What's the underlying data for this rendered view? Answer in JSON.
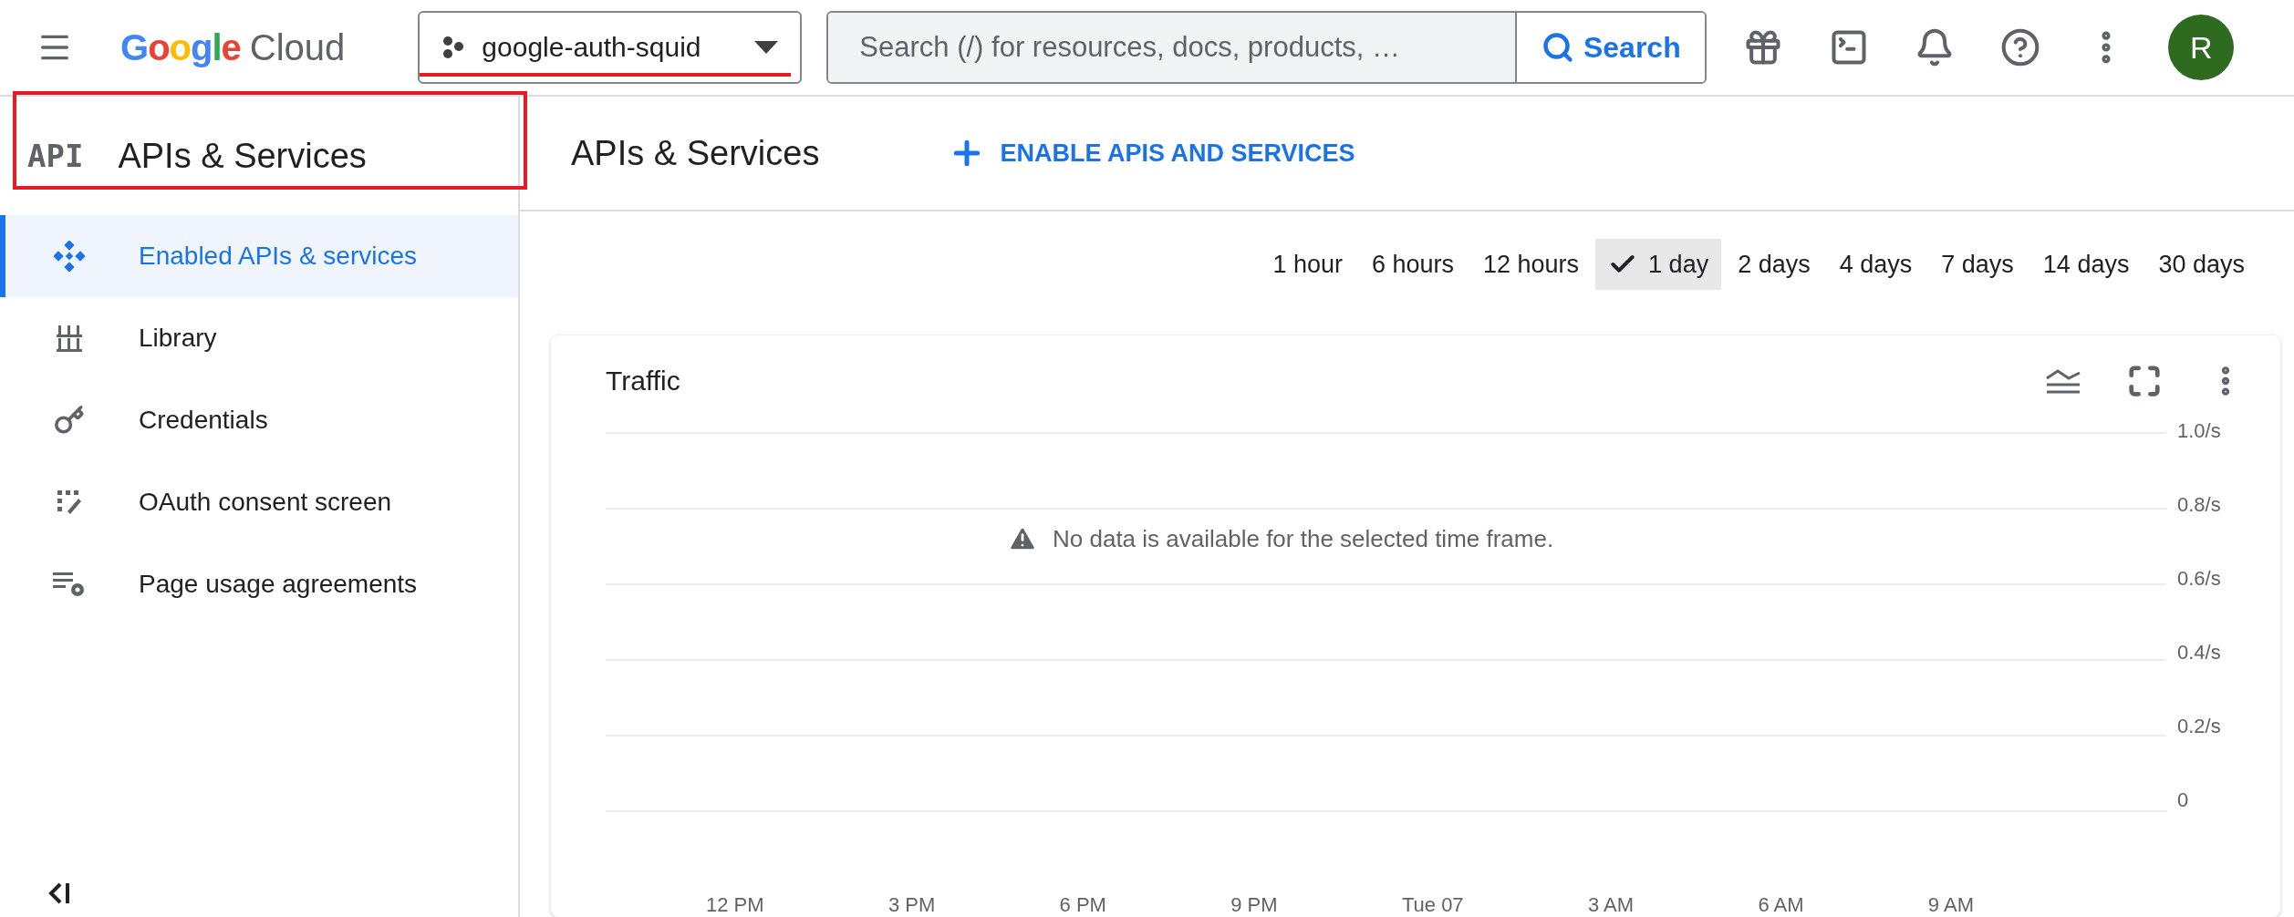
{
  "topbar": {
    "logo_brand": "Google",
    "logo_product": "Cloud",
    "project": "google-auth-squid",
    "search": {
      "placeholder": "Search (/) for resources, docs, products, …",
      "button": "Search"
    },
    "avatar": "R"
  },
  "sidebar": {
    "badge": "API",
    "title": "APIs & Services",
    "items": [
      {
        "label": "Enabled APIs & services",
        "kind": "enabled",
        "selected": true
      },
      {
        "label": "Library",
        "kind": "library",
        "selected": false
      },
      {
        "label": "Credentials",
        "kind": "credentials",
        "selected": false
      },
      {
        "label": "OAuth consent screen",
        "kind": "oauth",
        "selected": false
      },
      {
        "label": "Page usage agreements",
        "kind": "agreements",
        "selected": false
      }
    ]
  },
  "header": {
    "title": "APIs & Services",
    "action": "ENABLE APIS AND SERVICES"
  },
  "time_ranges": [
    {
      "label": "1 hour",
      "selected": false
    },
    {
      "label": "6 hours",
      "selected": false
    },
    {
      "label": "12 hours",
      "selected": false
    },
    {
      "label": "1 day",
      "selected": true
    },
    {
      "label": "2 days",
      "selected": false
    },
    {
      "label": "4 days",
      "selected": false
    },
    {
      "label": "7 days",
      "selected": false
    },
    {
      "label": "14 days",
      "selected": false
    },
    {
      "label": "30 days",
      "selected": false
    }
  ],
  "chart": {
    "title": "Traffic",
    "message": "No data is available for the selected time frame.",
    "y_labels": [
      "1.0/s",
      "0.8/s",
      "0.6/s",
      "0.4/s",
      "0.2/s",
      "0"
    ],
    "x_labels": [
      "12 PM",
      "3 PM",
      "6 PM",
      "9 PM",
      "Tue 07",
      "3 AM",
      "6 AM",
      "9 AM"
    ]
  }
}
